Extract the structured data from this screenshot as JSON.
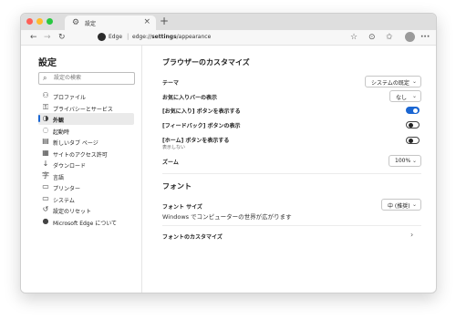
{
  "window": {
    "traffic_lights": {
      "close": "#fe5f57",
      "minimize": "#febc2e",
      "maximize": "#28c840"
    },
    "tab": {
      "icon": "gear-icon",
      "title": "設定",
      "close_glyph": "×"
    },
    "new_tab_glyph": "+"
  },
  "toolbar": {
    "back": "←",
    "forward": "→",
    "refresh": "↻",
    "site_name": "Edge",
    "separator": "|",
    "url_prefix": "edge://",
    "url_bold": "settings",
    "url_suffix": "/appearance",
    "star": "☆",
    "extension": "⊙",
    "favorites": "✩",
    "collections": "⧉"
  },
  "sidebar": {
    "title": "設定",
    "search_placeholder": "設定の検索",
    "items": [
      {
        "icon": "profile-icon",
        "glyph": "⚇",
        "label": "プロファイル"
      },
      {
        "icon": "lock-icon",
        "glyph": "🔒",
        "label": "プライバシーとサービス"
      },
      {
        "icon": "palette-icon",
        "glyph": "◑",
        "label": "外観",
        "active": true
      },
      {
        "icon": "power-icon",
        "glyph": "⏻",
        "label": "起動時"
      },
      {
        "icon": "new-tab-icon",
        "glyph": "▤",
        "label": "新しいタブ ページ"
      },
      {
        "icon": "site-permissions-icon",
        "glyph": "▦",
        "label": "サイトのアクセス許可"
      },
      {
        "icon": "download-icon",
        "glyph": "⤓",
        "label": "ダウンロード"
      },
      {
        "icon": "language-icon",
        "glyph": "字",
        "label": "言語"
      },
      {
        "icon": "printer-icon",
        "glyph": "⎙",
        "label": "プリンター"
      },
      {
        "icon": "system-icon",
        "glyph": "▭",
        "label": "システム"
      },
      {
        "icon": "reset-icon",
        "glyph": "↺",
        "label": "設定のリセット"
      },
      {
        "icon": "edge-logo-icon",
        "glyph": "●",
        "label": "Microsoft Edge について"
      }
    ]
  },
  "main": {
    "customize_heading": "ブラウザーのカスタマイズ",
    "theme": {
      "label": "テーマ",
      "value": "システムの既定"
    },
    "favorites_bar": {
      "label": "お気に入りバーの表示",
      "value": "なし"
    },
    "favorites_button": {
      "label": "[お気に入り] ボタンを表示する",
      "on": true
    },
    "feedback_button": {
      "label": "[フィードバック] ボタンの表示",
      "on": false
    },
    "home_button": {
      "label": "[ホーム] ボタンを表示する",
      "sub": "表示しない",
      "on": false
    },
    "zoom": {
      "label": "ズーム",
      "value": "100%"
    },
    "fonts_heading": "フォント",
    "font_size": {
      "label": "フォント サイズ",
      "value": "中 (推奨)"
    },
    "font_preview": "Windows でコンピューターの世界が広がります",
    "customize_fonts": {
      "label": "フォントのカスタマイズ",
      "chevron": "›"
    },
    "dropdown_chevron": "⌄",
    "accent_color": "#1a66d2"
  }
}
